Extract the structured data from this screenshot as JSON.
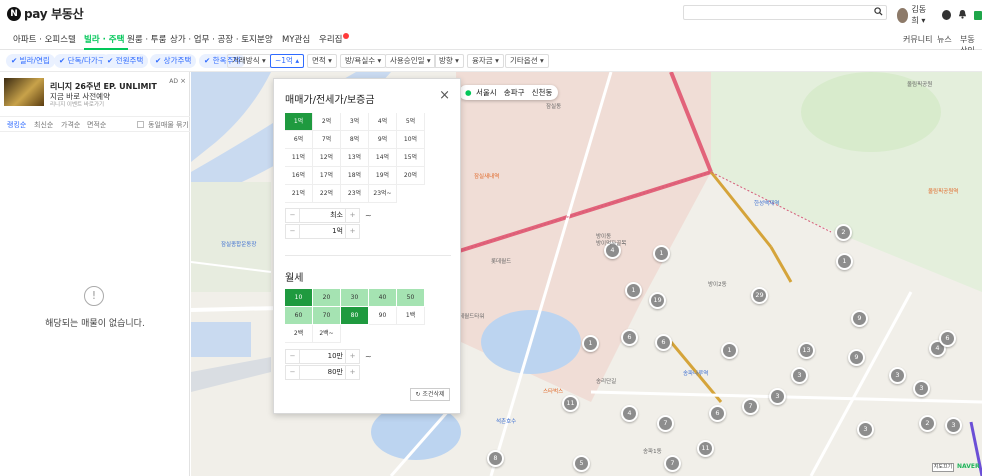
{
  "header": {
    "logo_badge": "N",
    "logo_text": "pay 부동산",
    "search_placeholder": "",
    "user_name": "김동희 ▾"
  },
  "nav": {
    "items": [
      {
        "label": "아파트 · 오피스텔"
      },
      {
        "label": "빌라 · 주택",
        "active": true
      },
      {
        "label": "원룸 · 투룸"
      },
      {
        "label": "상가 · 업무 · 공장 · 토지"
      },
      {
        "label": "분양"
      },
      {
        "label": "MY관심"
      },
      {
        "label": "우리집"
      }
    ],
    "right": [
      "커뮤니티",
      "뉴스",
      "부동산인"
    ]
  },
  "filters": {
    "chips": [
      "✔ 빌라/연립",
      "✔ 단독/다가구",
      "✔ 전원주택",
      "✔ 상가주택",
      "✔ 한옥주택"
    ],
    "dropdowns": [
      "거래방식 ▾",
      "~1억 ▴",
      "면적 ▾",
      "방/욕실수 ▾",
      "사용승인일 ▾",
      "방향 ▾",
      "융자금 ▾",
      "기타옵션 ▾"
    ]
  },
  "ad": {
    "title": "리니지 26주년 EP. UNLIMIT",
    "subtitle": "지금 바로 사전예약",
    "fine": "리니지 이벤트 바로가기",
    "tag": "AD",
    "close": "×"
  },
  "sort": {
    "options": [
      "랭킹순",
      "최신순",
      "가격순",
      "면적순"
    ],
    "checkbox_label": "동일매물 묶기"
  },
  "empty": {
    "icon": "!",
    "text": "해당되는 매물이 없습니다."
  },
  "price_panel": {
    "title": "매매가/전세가/보증금",
    "close": "×",
    "grid": [
      "1억",
      "2억",
      "3억",
      "4억",
      "5억",
      "6억",
      "7억",
      "8억",
      "9억",
      "10억",
      "11억",
      "12억",
      "13억",
      "14억",
      "15억",
      "16억",
      "17억",
      "18억",
      "19억",
      "20억",
      "21억",
      "22억",
      "23억",
      "23억~"
    ],
    "selected": "1억",
    "min_value": "최소",
    "max_value": "1억",
    "minus": "−",
    "plus": "+",
    "tilde": "~"
  },
  "rent_panel": {
    "title": "월세",
    "grid": [
      "10",
      "20",
      "30",
      "40",
      "50",
      "60",
      "70",
      "80",
      "90",
      "1백",
      "2백",
      "2백~"
    ],
    "selected": "80",
    "range_start": "10",
    "min_value": "10만",
    "max_value": "80만",
    "reset": "↻ 조건삭제"
  },
  "map": {
    "breadcrumb_pin": "●",
    "breadcrumb": [
      "서울시",
      "송파구",
      "신천동"
    ],
    "markers": [
      "4",
      "19",
      "29",
      "1",
      "1",
      "1",
      "1",
      "6",
      "1",
      "6",
      "13",
      "4",
      "11",
      "4",
      "7",
      "6",
      "9",
      "11",
      "7",
      "3",
      "2",
      "3",
      "3",
      "8",
      "5",
      "7",
      "2",
      "3",
      "3",
      "3",
      "6",
      "9"
    ],
    "pois": [
      {
        "name": "올림픽공원",
        "cls": "gray"
      },
      {
        "name": "잠실동",
        "cls": "gray"
      },
      {
        "name": "잠실새내역",
        "cls": "orange"
      },
      {
        "name": "롯데월드",
        "cls": "gray"
      },
      {
        "name": "방이동",
        "cls": "gray"
      },
      {
        "name": "방이먹자골목",
        "cls": "gray"
      },
      {
        "name": "방이2동",
        "cls": "gray"
      },
      {
        "name": "한성백제역",
        "cls": "blue"
      },
      {
        "name": "송파나루역",
        "cls": "blue"
      },
      {
        "name": "석촌호수",
        "cls": "blue"
      },
      {
        "name": "송리단길",
        "cls": "gray"
      },
      {
        "name": "송파1동",
        "cls": "gray"
      },
      {
        "name": "롯데월드타워",
        "cls": "gray"
      },
      {
        "name": "올림픽공원역",
        "cls": "orange"
      },
      {
        "name": "스타벅스",
        "cls": "orange"
      },
      {
        "name": "잠실종합운동장",
        "cls": "blue"
      }
    ],
    "scale": "지도끄기",
    "naver": "NAVER"
  }
}
